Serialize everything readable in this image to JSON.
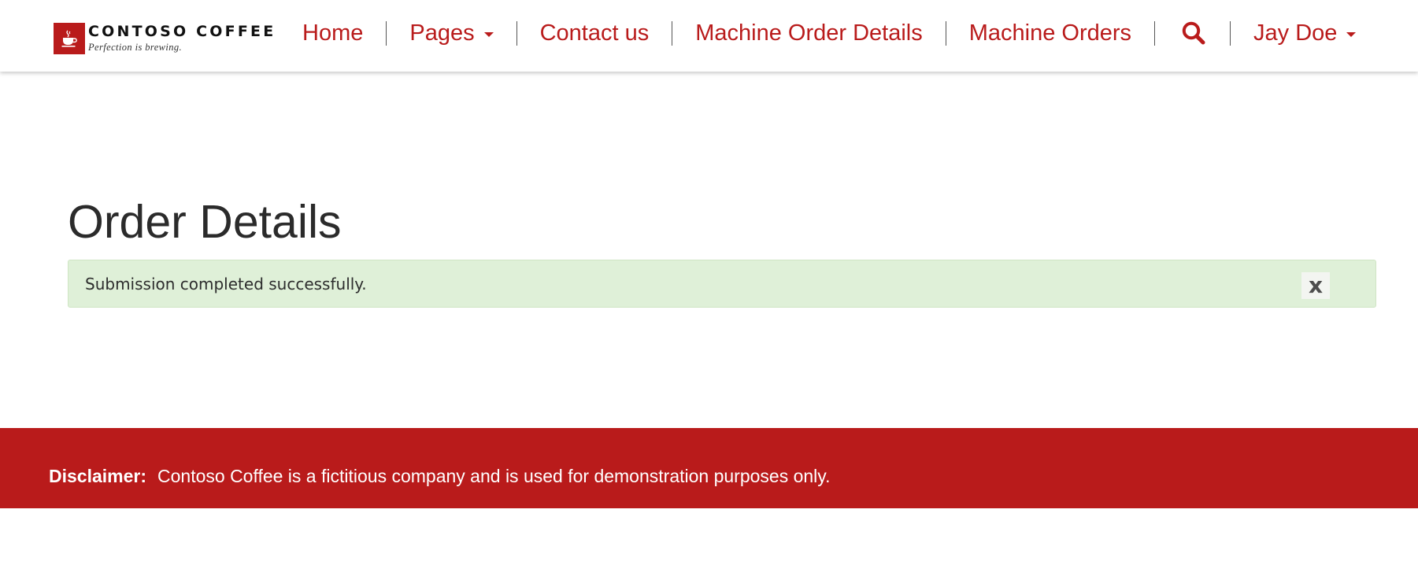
{
  "brand": {
    "name": "CONTOSO COFFEE",
    "tagline": "Perfection is brewing."
  },
  "nav": {
    "items": [
      {
        "label": "Home"
      },
      {
        "label": "Pages",
        "has_dropdown": true
      },
      {
        "label": "Contact us"
      },
      {
        "label": "Machine Order Details"
      },
      {
        "label": "Machine Orders"
      }
    ],
    "search_icon": "search-icon",
    "user": {
      "label": "Jay Doe",
      "has_dropdown": true
    }
  },
  "main": {
    "title": "Order Details",
    "alert": {
      "message": "Submission completed successfully.",
      "close_label": "x"
    }
  },
  "footer": {
    "label": "Disclaimer:",
    "text": "Contoso Coffee is a fictitious company and is used for demonstration purposes only."
  },
  "colors": {
    "brand_red": "#b91b1b",
    "alert_bg": "#dff0d8",
    "title_text": "#2b2b2b"
  }
}
